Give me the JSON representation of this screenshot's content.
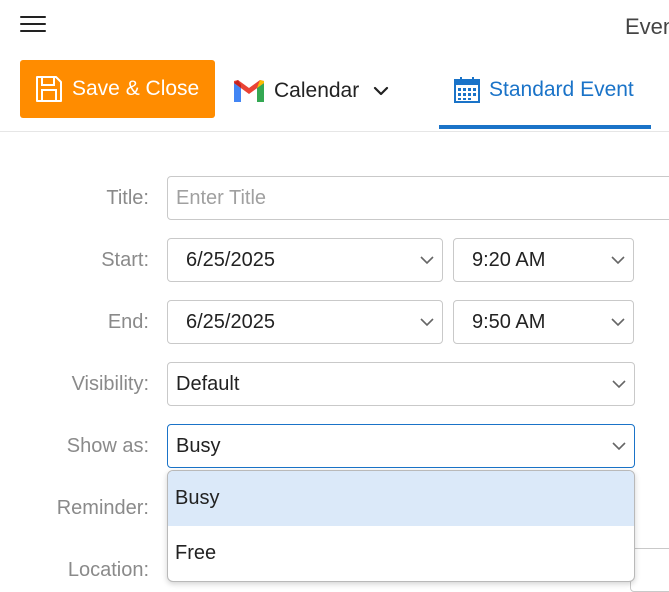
{
  "window": {
    "title": "Event"
  },
  "toolbar": {
    "save_label": "Save & Close",
    "calendar_label": "Calendar",
    "tab_label": "Standard Event"
  },
  "form": {
    "title": {
      "label": "Title:",
      "placeholder": "Enter Title",
      "value": ""
    },
    "start": {
      "label": "Start:",
      "date": "6/25/2025",
      "time": "9:20 AM"
    },
    "end": {
      "label": "End:",
      "date": "6/25/2025",
      "time": "9:50 AM"
    },
    "visibility": {
      "label": "Visibility:",
      "value": "Default"
    },
    "show_as": {
      "label": "Show as:",
      "value": "Busy",
      "options": [
        "Busy",
        "Free"
      ]
    },
    "reminder": {
      "label": "Reminder:"
    },
    "location": {
      "label": "Location:"
    }
  },
  "colors": {
    "accent": "#1a73c8",
    "save_button": "#ff8c00",
    "selected_option": "#dbe9f9"
  },
  "icons": [
    "menu-icon",
    "save-icon",
    "gmail-icon",
    "chevron-down-icon",
    "calendar-grid-icon"
  ]
}
